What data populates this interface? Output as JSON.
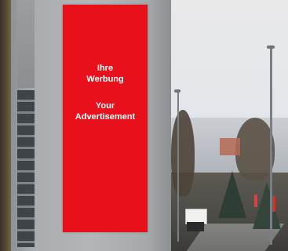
{
  "image": {
    "billboard": {
      "text_german": "Ihre Werbung",
      "text_english": "Your Advertisement",
      "background_color": "#e8111b",
      "text_color": "#ffffff"
    }
  }
}
